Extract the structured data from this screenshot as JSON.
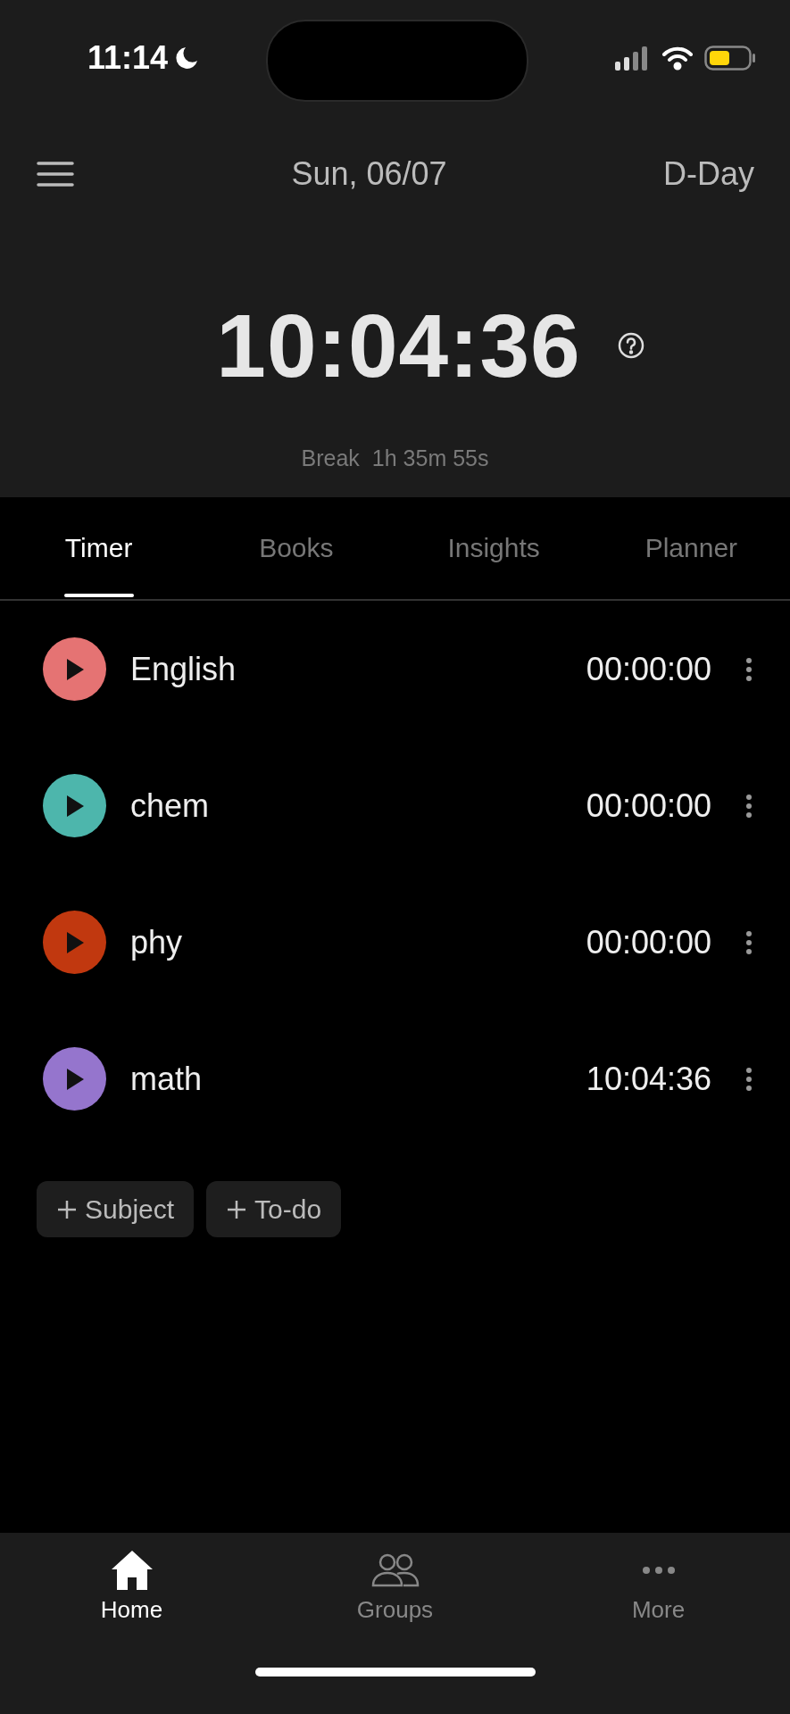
{
  "status_bar": {
    "time": "11:14"
  },
  "header": {
    "date": "Sun, 06/07",
    "d_day": "D-Day"
  },
  "clock": {
    "time": "10:04:36",
    "break_label": "Break",
    "break_time": "1h 35m 55s"
  },
  "tabs": [
    {
      "label": "Timer",
      "selected": true
    },
    {
      "label": "Books",
      "selected": false
    },
    {
      "label": "Insights",
      "selected": false
    },
    {
      "label": "Planner",
      "selected": false
    }
  ],
  "subjects": [
    {
      "name": "English",
      "time": "00:00:00",
      "color": "#e57373"
    },
    {
      "name": "chem",
      "time": "00:00:00",
      "color": "#4db6ac"
    },
    {
      "name": "phy",
      "time": "00:00:00",
      "color": "#c1380f"
    },
    {
      "name": "math",
      "time": "10:04:36",
      "color": "#9575cd"
    }
  ],
  "actions": [
    {
      "label": "Subject"
    },
    {
      "label": "To-do"
    }
  ],
  "bottom_nav": [
    {
      "label": "Home",
      "kind": "home",
      "selected": true
    },
    {
      "label": "Groups",
      "kind": "groups",
      "selected": false
    },
    {
      "label": "More",
      "kind": "more",
      "selected": false
    }
  ]
}
